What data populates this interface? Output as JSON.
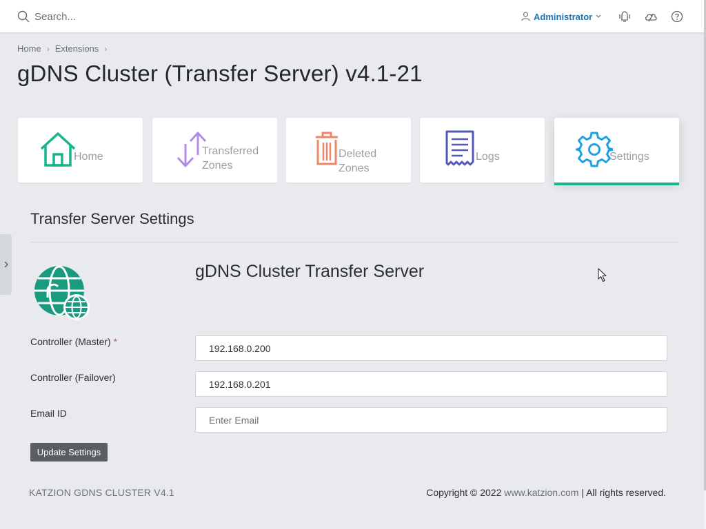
{
  "topbar": {
    "search_placeholder": "Search...",
    "user_label": "Administrator",
    "icons": [
      "search-icon",
      "user-icon",
      "chevron-down-icon",
      "notifications-icon",
      "cloud-icon",
      "help-icon"
    ]
  },
  "breadcrumb": {
    "items": [
      "Home",
      "Extensions"
    ]
  },
  "page": {
    "title": "gDNS Cluster (Transfer Server) v4.1-21"
  },
  "tiles": [
    {
      "line1": "Home",
      "line2": "",
      "icon": "home-icon",
      "color": "#17b48a",
      "active": false
    },
    {
      "line1": "Transferred",
      "line2": "Zones",
      "icon": "transfer-arrows-icon",
      "color": "#b38be6",
      "active": false
    },
    {
      "line1": "Deleted",
      "line2": "Zones",
      "icon": "trash-icon",
      "color": "#f1856a",
      "active": false
    },
    {
      "line1": "Logs",
      "line2": "",
      "icon": "receipt-icon",
      "color": "#5257b8",
      "active": false
    },
    {
      "line1": "Settings",
      "line2": "",
      "icon": "gear-icon",
      "color": "#1aa1e6",
      "active": true
    }
  ],
  "settings": {
    "section_title": "Transfer Server Settings",
    "product_title": "gDNS Cluster Transfer Server",
    "fields": {
      "master": {
        "label": "Controller (Master)",
        "required_mark": "*",
        "value": "192.168.0.200"
      },
      "failover": {
        "label": "Controller (Failover)",
        "value": "192.168.0.201"
      },
      "email": {
        "label": "Email ID",
        "value": "",
        "placeholder": "Enter Email"
      }
    },
    "update_button": "Update Settings"
  },
  "footer": {
    "left": "KATZION GDNS CLUSTER V4.1",
    "copyright": "Copyright © 2022",
    "link": "www.katzion.com",
    "rights": "| All rights reserved."
  },
  "colors": {
    "accent": "#17b48a",
    "link": "#1b73b3",
    "logo": "#1a9a7e"
  }
}
